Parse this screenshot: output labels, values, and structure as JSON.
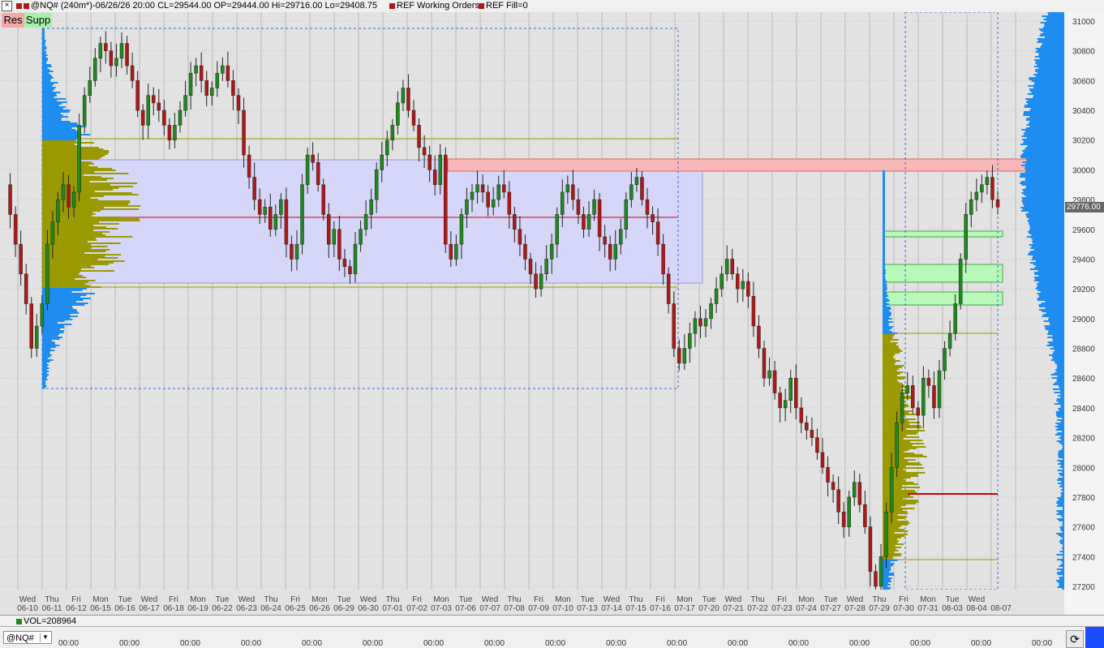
{
  "title": {
    "symbol_info": "@NQ# (240m*)-06/26/26 20:00 CL=29544.00 OP=29444.00 Hi=29716.00 Lo=29408.75",
    "working_orders": "REF Working Orders",
    "fill": "REF Fill=0"
  },
  "buttons": {
    "res": "Res",
    "supp": "Supp"
  },
  "price_axis": {
    "labels": [
      "31000",
      "30800",
      "30600",
      "30400",
      "30200",
      "30000",
      "29800",
      "29600",
      "29400",
      "29200",
      "29000",
      "28800",
      "28600",
      "28400",
      "28200",
      "28000",
      "27800",
      "27600",
      "27400",
      "27200"
    ],
    "current_price": "29776.00"
  },
  "date_axis": {
    "days": [
      "Wed",
      "Thu",
      "Fri",
      "Mon",
      "Tue",
      "Wed",
      "Fri",
      "Mon",
      "Tue",
      "Wed",
      "Thu",
      "Fri",
      "Mon",
      "Tue",
      "Wed",
      "Thu",
      "Fri",
      "Mon",
      "Tue",
      "Wed",
      "Thu",
      "Fri",
      "Mon",
      "Tue",
      "Wed",
      "Thu",
      "Fri",
      "Mon",
      "Tue",
      "Wed",
      "Thu",
      "Fri",
      "Mon",
      "Tue",
      "Wed",
      "Thu",
      "Fri",
      "Mon",
      "Tue",
      "Wed"
    ],
    "dates": [
      "06-10",
      "06-11",
      "06-12",
      "06-15",
      "06-16",
      "06-17",
      "06-18",
      "06-19",
      "06-22",
      "06-23",
      "06-24",
      "06-25",
      "06-26",
      "06-29",
      "06-30",
      "07-01",
      "07-02",
      "07-03",
      "07-06",
      "07-07",
      "07-08",
      "07-09",
      "07-10",
      "07-13",
      "07-14",
      "07-15",
      "07-16",
      "07-17",
      "07-20",
      "07-21",
      "07-22",
      "07-23",
      "07-24",
      "07-27",
      "07-28",
      "07-29",
      "07-30",
      "07-31",
      "08-03",
      "08-04",
      "08-07"
    ]
  },
  "volume_bar": {
    "label": "VOL=208964"
  },
  "bottom": {
    "symbol": "@NQ#",
    "times": [
      "00:00",
      "00:00",
      "00:00",
      "00:00",
      "00:00",
      "00:00",
      "00:00",
      "00:00",
      "00:00",
      "00:00",
      "00:00",
      "00:00",
      "00:00",
      "00:00",
      "00:00",
      "00:00",
      "00:00"
    ]
  },
  "colors": {
    "up_candle": "#1e8a1e",
    "down_candle": "#b01818",
    "value_area": "#9a9a00",
    "profile_blue": "#1e8cf0",
    "resistance_zone": "#f8b8b8",
    "support_zone": "#b8f8b8",
    "range_box": "#d6d6f8"
  }
}
